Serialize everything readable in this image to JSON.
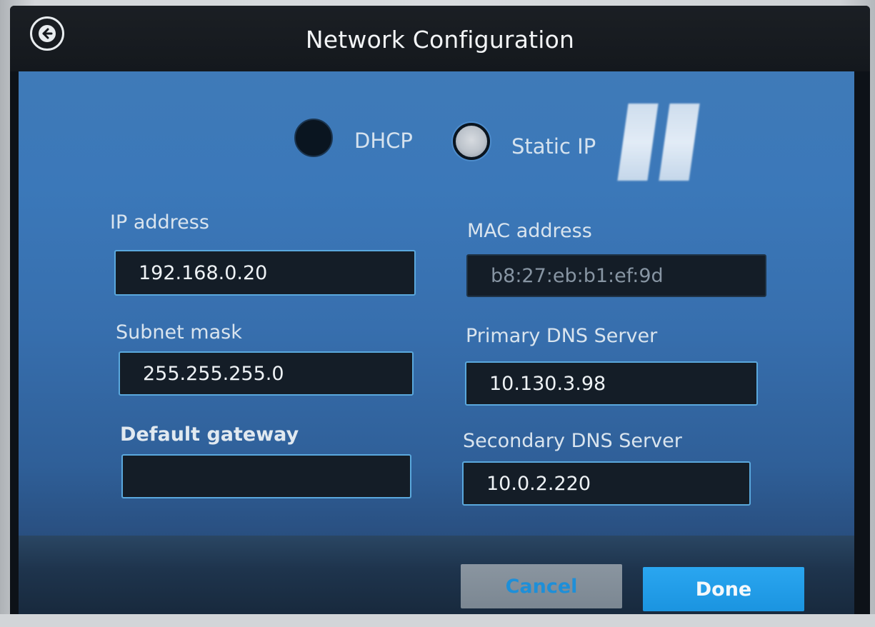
{
  "header": {
    "title": "Network Configuration",
    "back_icon": "back-arrow-icon"
  },
  "mode": {
    "options": [
      {
        "label": "DHCP",
        "selected": false
      },
      {
        "label": "Static IP",
        "selected": true
      }
    ]
  },
  "fields": {
    "ip_address": {
      "label": "IP address",
      "value": "192.168.0.20"
    },
    "mac_address": {
      "label": "MAC address",
      "value": "b8:27:eb:b1:ef:9d"
    },
    "subnet_mask": {
      "label": "Subnet mask",
      "value": "255.255.255.0"
    },
    "primary_dns": {
      "label": "Primary DNS Server",
      "value": "10.130.3.98"
    },
    "default_gateway": {
      "label": "Default gateway",
      "value": ""
    },
    "secondary_dns": {
      "label": "Secondary DNS Server",
      "value": "10.0.2.220"
    }
  },
  "footer": {
    "cancel_label": "Cancel",
    "done_label": "Done"
  },
  "colors": {
    "panel_blue": "#3b78b9",
    "field_border": "#5aa8dd",
    "done_button": "#1b94e0",
    "cancel_text": "#1e8fd8"
  }
}
